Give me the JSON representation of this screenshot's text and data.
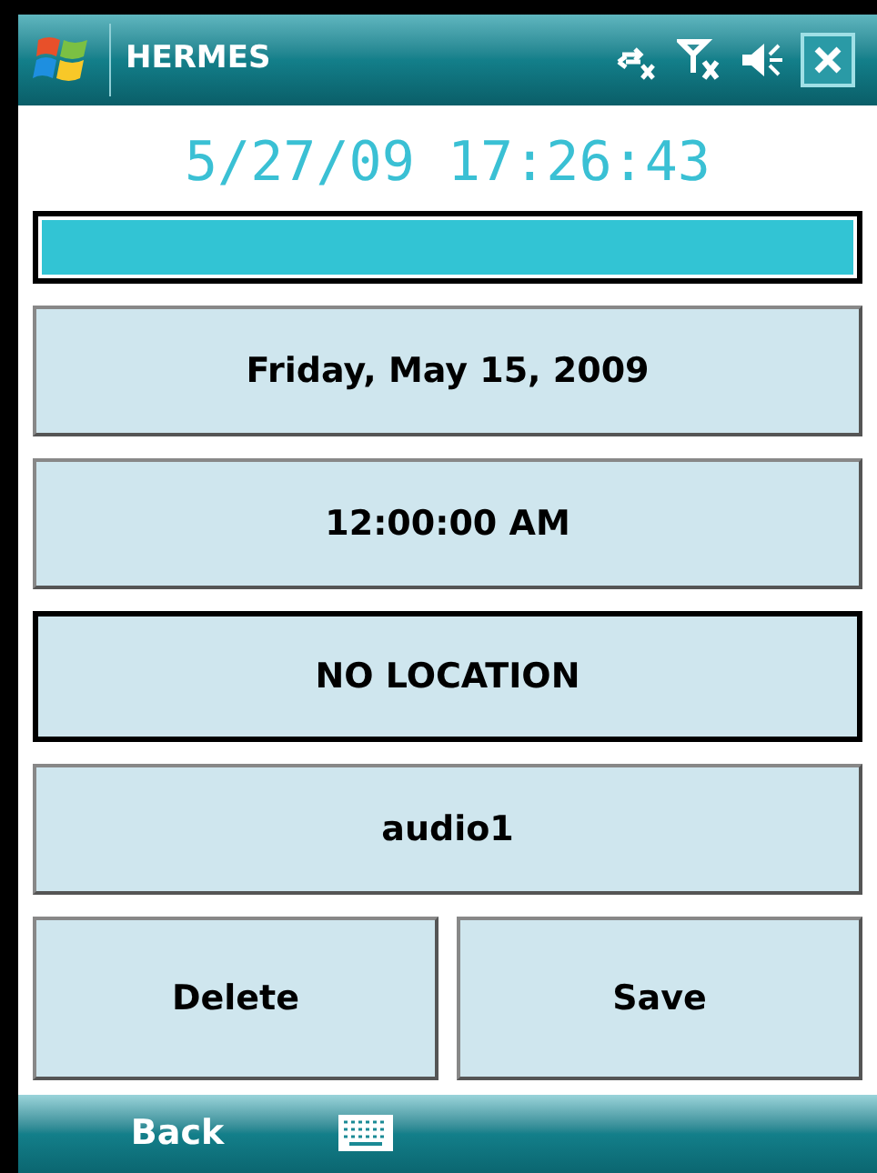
{
  "title_bar": {
    "title": "HERMES"
  },
  "clock": "5/27/09 17:26:43",
  "progress": {
    "level": 1
  },
  "fields": [
    {
      "label": "Friday, May 15, 2009",
      "focused": false
    },
    {
      "label": "12:00:00 AM",
      "focused": false
    },
    {
      "label": "NO LOCATION",
      "focused": true
    },
    {
      "label": "audio1",
      "focused": false
    }
  ],
  "actions": [
    {
      "label": "Delete",
      "focused": false
    },
    {
      "label": "Save",
      "focused": false
    }
  ],
  "menu_bar": {
    "left": "Back"
  }
}
